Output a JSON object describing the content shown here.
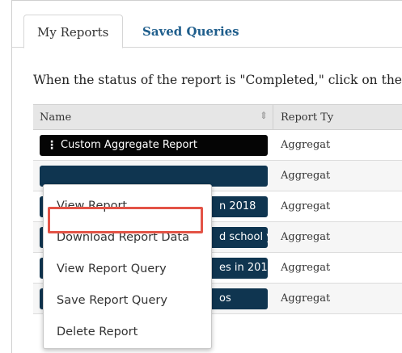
{
  "tabs": [
    {
      "label": "My Reports",
      "active": true
    },
    {
      "label": "Saved Queries",
      "active": false
    }
  ],
  "instruction": "When the status of the report is \"Completed,\" click on the",
  "table": {
    "headers": {
      "name": "Name",
      "type": "Report Ty"
    },
    "rows": [
      {
        "name": "Custom Aggregate Report",
        "type": "Aggregat"
      },
      {
        "name": "",
        "type": "Aggregat"
      },
      {
        "name": "n 2018",
        "type": "Aggregat"
      },
      {
        "name": "d school years by pr...",
        "type": "Aggregat"
      },
      {
        "name": "es in 2019",
        "type": "Aggregat"
      },
      {
        "name": "os",
        "type": "Aggregat"
      }
    ]
  },
  "menu": {
    "items": [
      {
        "label": "View Report"
      },
      {
        "label": "Download Report Data",
        "highlighted": true
      },
      {
        "label": "View Report Query"
      },
      {
        "label": "Save Report Query"
      },
      {
        "label": "Delete Report"
      }
    ]
  },
  "colors": {
    "accent_link": "#1f5e8c",
    "pill": "#0f3550",
    "pill_active": "#050505",
    "highlight": "#e35346"
  }
}
